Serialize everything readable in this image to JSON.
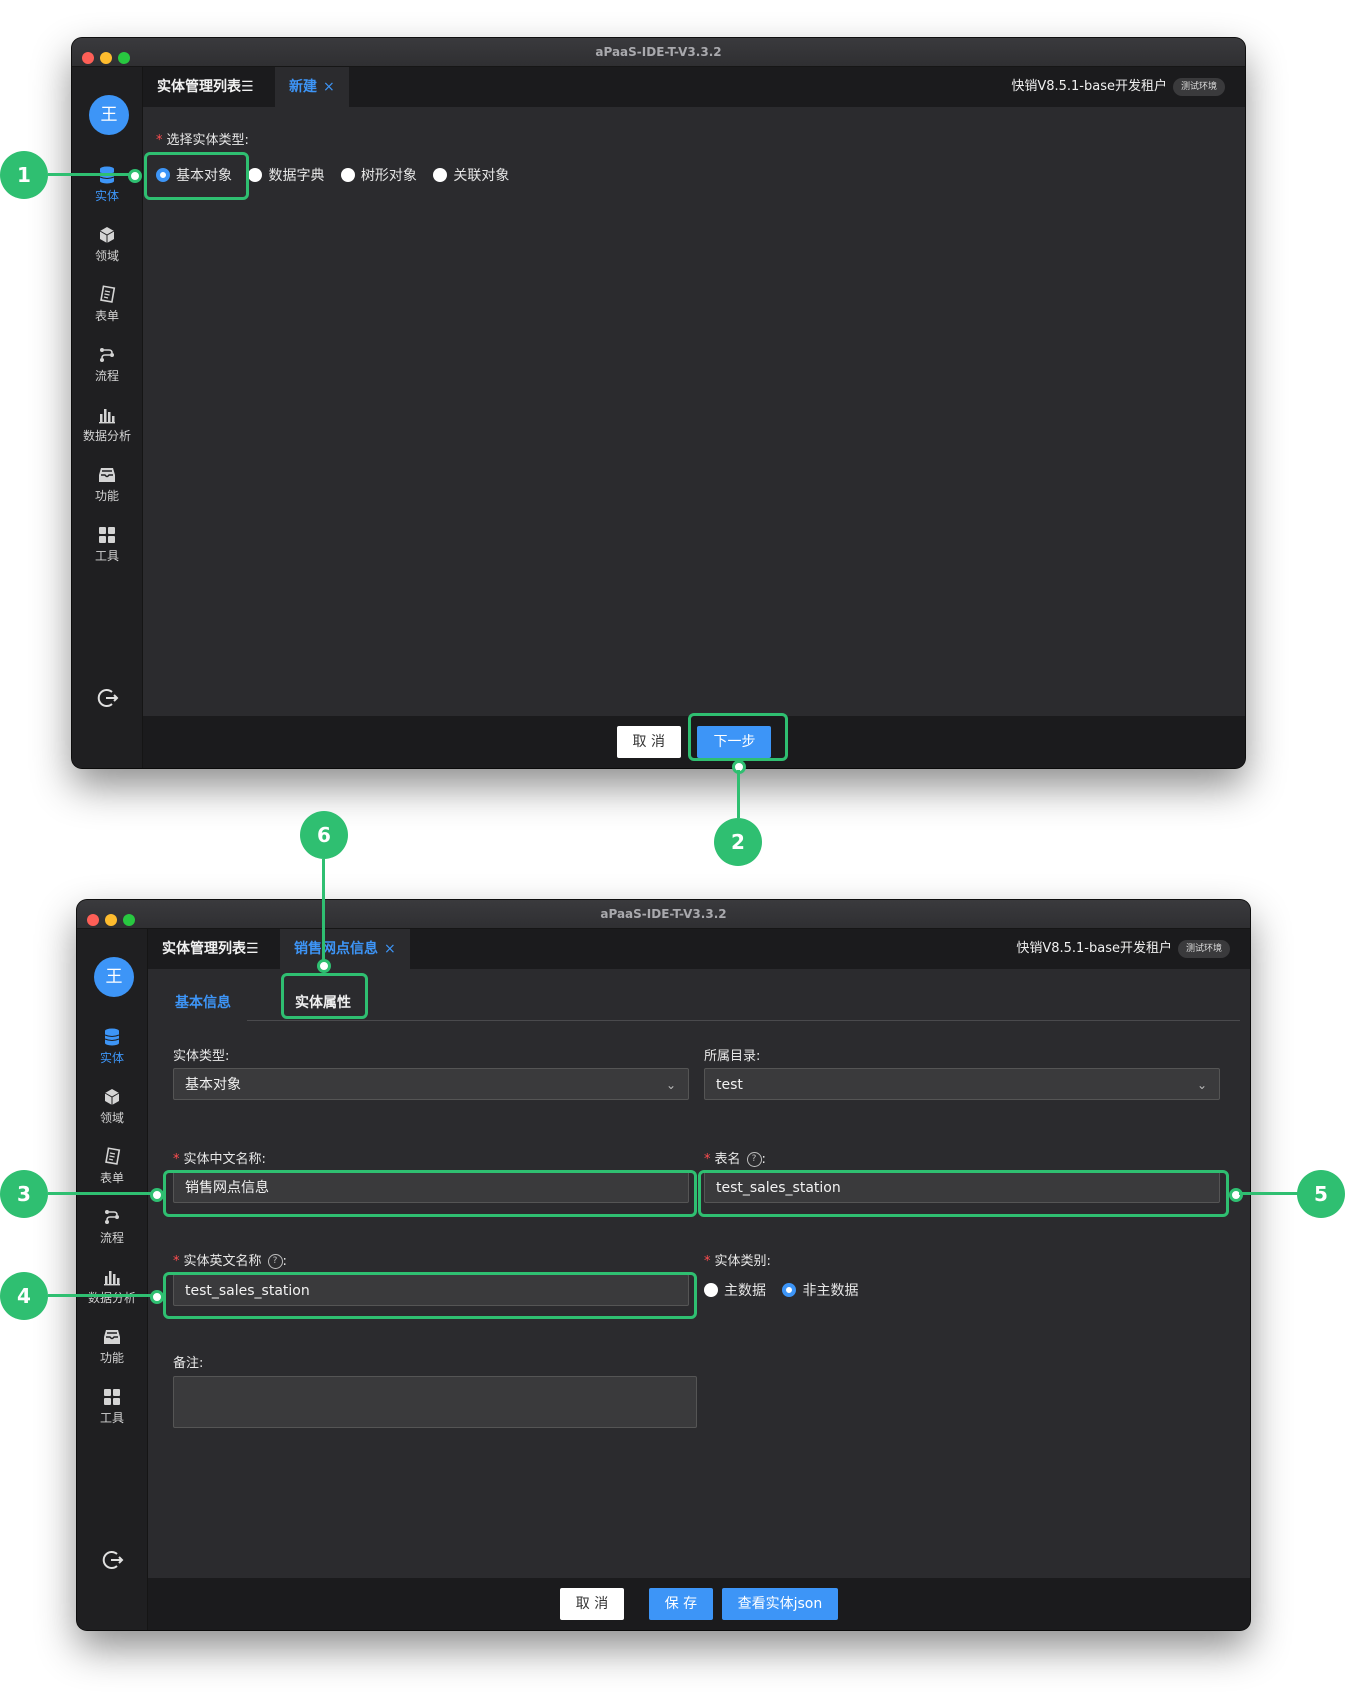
{
  "app_title": "aPaaS-IDE-T-V3.3.2",
  "avatar_text": "王",
  "sidebar": {
    "items": [
      {
        "label": "实体",
        "icon": "database-icon",
        "active": true
      },
      {
        "label": "领域",
        "icon": "cube-icon"
      },
      {
        "label": "表单",
        "icon": "form-icon"
      },
      {
        "label": "流程",
        "icon": "flow-icon"
      },
      {
        "label": "数据分析",
        "icon": "bar-chart-icon"
      },
      {
        "label": "功能",
        "icon": "inbox-icon"
      },
      {
        "label": "工具",
        "icon": "grid-icon"
      }
    ],
    "logout_icon": "logout-icon"
  },
  "header": {
    "tenant": "快销V8.5.1-base开发租户",
    "env_badge": "测试环境"
  },
  "screen1": {
    "tab_list": "实体管理列表☰",
    "tab_new": "新建",
    "field_label": "选择实体类型:",
    "options": [
      "基本对象",
      "数据字典",
      "树形对象",
      "关联对象"
    ],
    "selected": "基本对象",
    "cancel": "取 消",
    "next": "下一步"
  },
  "screen2": {
    "tab_list": "实体管理列表☰",
    "tab_detail": "销售网点信息",
    "subtab_basic": "基本信息",
    "subtab_attrs": "实体属性",
    "entity_type_label": "实体类型:",
    "entity_type_value": "基本对象",
    "catalog_label": "所属目录:",
    "catalog_value": "test",
    "cn_name_label": "实体中文名称:",
    "cn_name_value": "销售网点信息",
    "table_name_label": "表名",
    "table_name_value": "test_sales_station",
    "en_name_label": "实体英文名称",
    "en_name_value": "test_sales_station",
    "category_label": "实体类别:",
    "category_options": [
      "主数据",
      "非主数据"
    ],
    "category_selected": "非主数据",
    "remark_label": "备注:",
    "cancel": "取 消",
    "save": "保 存",
    "view_json": "查看实体json"
  },
  "callouts": [
    "1",
    "2",
    "3",
    "4",
    "5",
    "6"
  ],
  "colors": {
    "accent": "#3d95f7",
    "callout": "#2fbf71",
    "window_bg": "#2b2b2e"
  }
}
